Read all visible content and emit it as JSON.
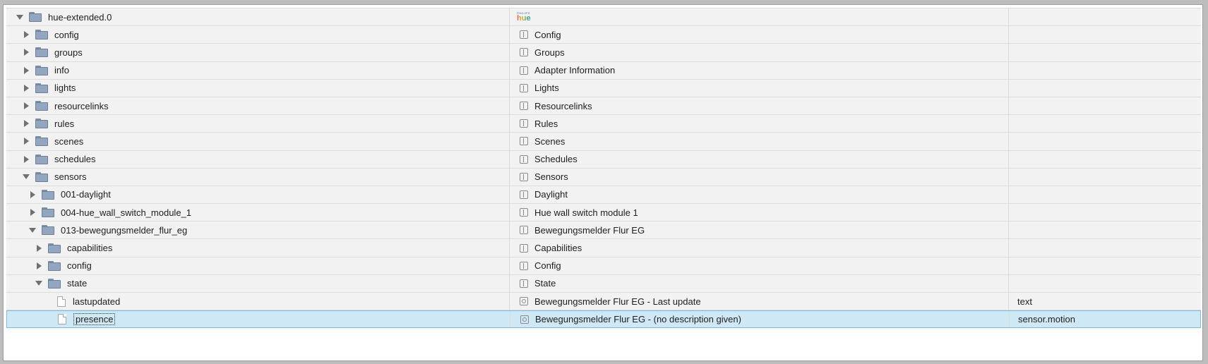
{
  "tree": {
    "rows": [
      {
        "name": "hue-extended.0",
        "desc": "",
        "type": "",
        "depth": 0,
        "kind": "folder",
        "expanded": true,
        "logo": true
      },
      {
        "name": "config",
        "desc": "Config",
        "type": "",
        "depth": 1,
        "kind": "folder",
        "expanded": false
      },
      {
        "name": "groups",
        "desc": "Groups",
        "type": "",
        "depth": 1,
        "kind": "folder",
        "expanded": false
      },
      {
        "name": "info",
        "desc": "Adapter Information",
        "type": "",
        "depth": 1,
        "kind": "folder",
        "expanded": false
      },
      {
        "name": "lights",
        "desc": "Lights",
        "type": "",
        "depth": 1,
        "kind": "folder",
        "expanded": false
      },
      {
        "name": "resourcelinks",
        "desc": "Resourcelinks",
        "type": "",
        "depth": 1,
        "kind": "folder",
        "expanded": false
      },
      {
        "name": "rules",
        "desc": "Rules",
        "type": "",
        "depth": 1,
        "kind": "folder",
        "expanded": false
      },
      {
        "name": "scenes",
        "desc": "Scenes",
        "type": "",
        "depth": 1,
        "kind": "folder",
        "expanded": false
      },
      {
        "name": "schedules",
        "desc": "Schedules",
        "type": "",
        "depth": 1,
        "kind": "folder",
        "expanded": false
      },
      {
        "name": "sensors",
        "desc": "Sensors",
        "type": "",
        "depth": 1,
        "kind": "folder",
        "expanded": true
      },
      {
        "name": "001-daylight",
        "desc": "Daylight",
        "type": "",
        "depth": 2,
        "kind": "folder",
        "expanded": false
      },
      {
        "name": "004-hue_wall_switch_module_1",
        "desc": "Hue wall switch module 1",
        "type": "",
        "depth": 2,
        "kind": "folder",
        "expanded": false
      },
      {
        "name": "013-bewegungsmelder_flur_eg",
        "desc": "Bewegungsmelder Flur EG",
        "type": "",
        "depth": 2,
        "kind": "folder",
        "expanded": true
      },
      {
        "name": "capabilities",
        "desc": "Capabilities",
        "type": "",
        "depth": 3,
        "kind": "folder",
        "expanded": false
      },
      {
        "name": "config",
        "desc": "Config",
        "type": "",
        "depth": 3,
        "kind": "folder",
        "expanded": false
      },
      {
        "name": "state",
        "desc": "State",
        "type": "",
        "depth": 3,
        "kind": "folder",
        "expanded": true
      },
      {
        "name": "lastupdated",
        "desc": "Bewegungsmelder Flur EG - Last update",
        "type": "text",
        "depth": 4,
        "kind": "state"
      },
      {
        "name": "presence",
        "desc": "Bewegungsmelder Flur EG - (no description given)",
        "type": "sensor.motion",
        "depth": 4,
        "kind": "state",
        "selected": true
      }
    ],
    "logo": {
      "brand": "PHILIPS",
      "product": "hue"
    }
  }
}
